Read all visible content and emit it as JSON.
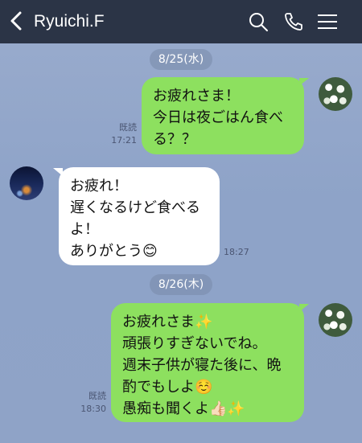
{
  "header": {
    "title": "Ryuichi.F",
    "back_icon": "chevron-left-icon",
    "search_icon": "search-icon",
    "phone_icon": "phone-icon",
    "menu_icon": "menu-icon",
    "bg_color": "#2b3446"
  },
  "colors": {
    "sent_bubble": "#8de05f",
    "received_bubble": "#ffffff",
    "background": "#8fa3c7"
  },
  "dates": [
    "8/25(水)",
    "8/26(木)"
  ],
  "messages": [
    {
      "direction": "sent",
      "text": "お疲れさま！\n今日は夜ごはん食べる？？",
      "read": "既読",
      "time": "17:21"
    },
    {
      "direction": "received",
      "text": "お疲れ！\n遅くなるけど食べるよ！\nありがとう😊",
      "time": "18:27"
    },
    {
      "direction": "sent",
      "text": "お疲れさま✨\n頑張りすぎないでね。\n週末子供が寝た後に、晩酌でもしよ☺️\n愚痴も聞くよ👍🏻✨",
      "read": "既読",
      "time": "18:30"
    }
  ]
}
